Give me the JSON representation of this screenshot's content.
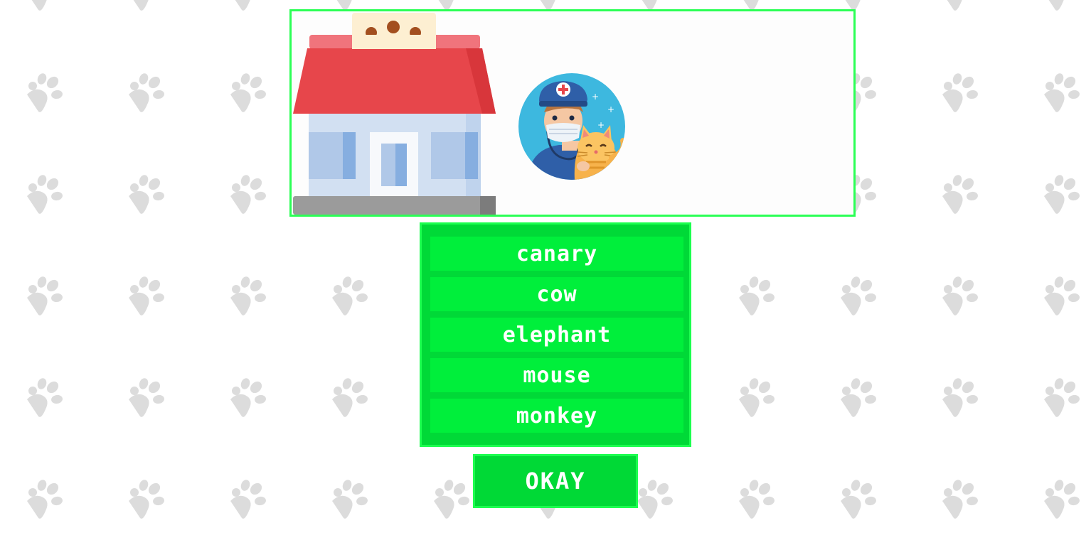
{
  "background": {
    "pattern_icon": "paw-print-icon",
    "pattern_color": "#dcdcdc"
  },
  "scene": {
    "building_icon": "pet-clinic-building-icon",
    "character_icon": "veterinarian-with-cat-icon",
    "border_color": "#2bff55"
  },
  "choices": {
    "items": [
      {
        "label": "canary"
      },
      {
        "label": "cow"
      },
      {
        "label": "elephant"
      },
      {
        "label": "mouse"
      },
      {
        "label": "monkey"
      }
    ],
    "panel_color": "#00d937",
    "item_color": "#00ef3b"
  },
  "actions": {
    "okay_label": "OKAY",
    "okay_color": "#00d936"
  }
}
